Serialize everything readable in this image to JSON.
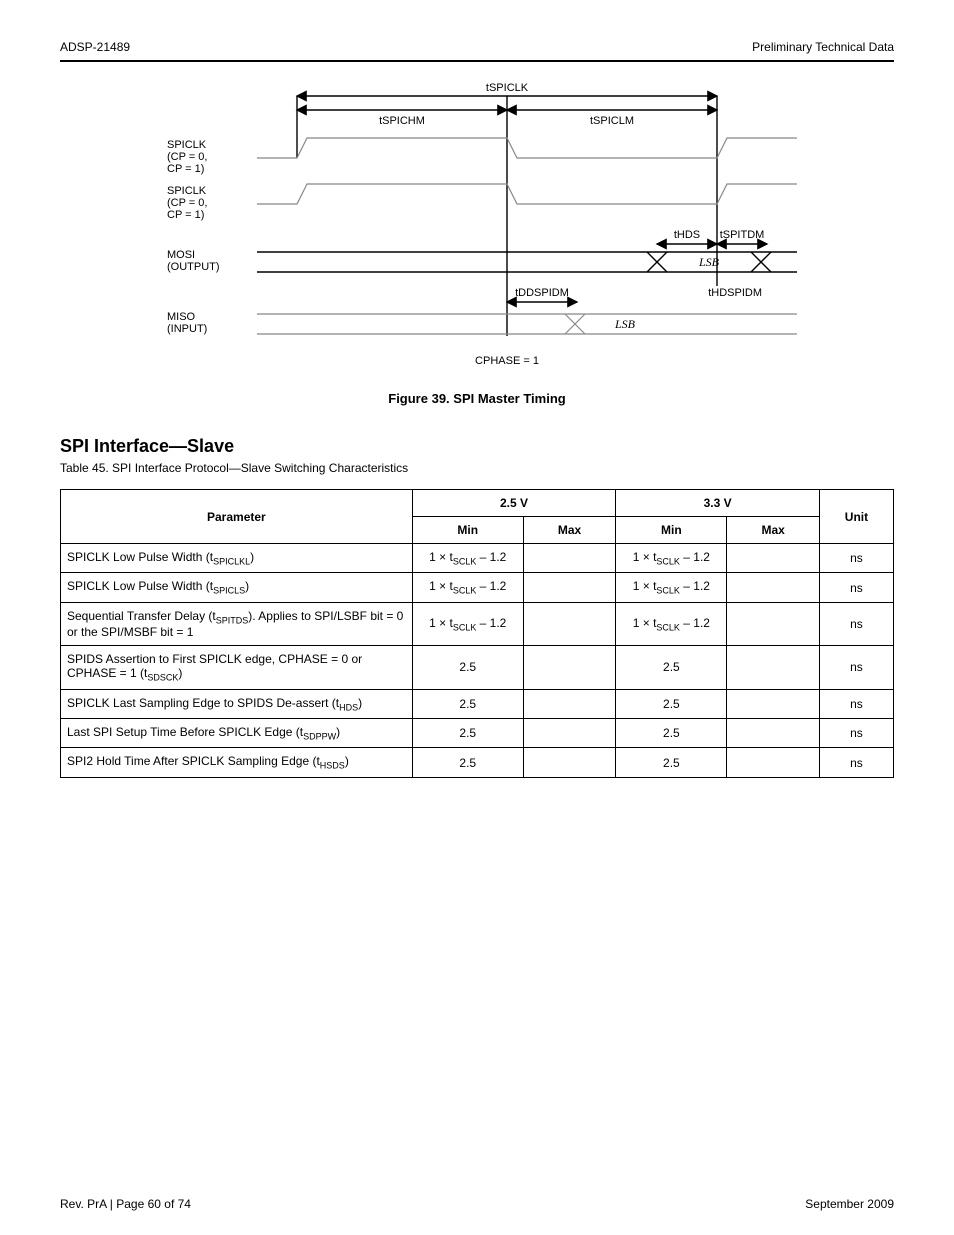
{
  "header": {
    "left": "ADSP-21489",
    "right": "Preliminary Technical Data"
  },
  "diagram": {
    "tSPICLK": "tSPICLK",
    "tHDS": "tHDS",
    "tSPITDM": "tSPITDM",
    "tSPICHM": "tSPICHM",
    "tSPICLM": "tSPICLM",
    "tDDSPIDM": "tDDSPIDM",
    "tHDSPIDM": "tHDSPIDM",
    "spiclk_cpol0": "SPICLK\n(CP = 0,\nCP = 1)",
    "spiclk_cpol1": "SPICLK\n(CP = 0,\nCP = 1)",
    "mosi_out": "MOSI\n(OUTPUT)",
    "miso_in": "MISO\n(INPUT)",
    "lsb_in": "LSB",
    "lsb_out": "LSB",
    "cphase1": "CPHASE = 1"
  },
  "figureCaption": "Figure 39. SPI Master Timing",
  "tableTitle": "SPI Interface—Slave",
  "tableSub": {
    "pre": "Table 45. SPI Interface Protocol—Slave Switching Characteristics",
    "post": ""
  },
  "cols": {
    "parameter": "Parameter",
    "min25": "Min",
    "max25": "Max",
    "min33": "Min",
    "max33": "Max",
    "unit": "Unit"
  },
  "voltHeaders": {
    "v25": "2.5 V",
    "v33": "3.3 V"
  },
  "rows": [
    {
      "desc": "SPICLK Low Pulse Width (tSPICLKL)",
      "descHtml": "SPICLK Low Pulse Width (t<sub>SPICLKL</sub>)",
      "min25": "1 × tSCLK – 1.2",
      "min25Html": "1 × t<sub>SCLK</sub> – 1.2",
      "max25": "",
      "min33": "1 × tSCLK – 1.2",
      "min33Html": "1 × t<sub>SCLK</sub> – 1.2",
      "max33": "",
      "unit": "ns"
    },
    {
      "desc": "SPICLK Low Pulse Width (tSPICLS)",
      "descHtml": "SPICLK Low Pulse Width (t<sub>SPICLS</sub>)",
      "min25": "1 × tSCLK – 1.2",
      "min25Html": "1 × t<sub>SCLK</sub> – 1.2",
      "max25": "",
      "min33": "1 × tSCLK – 1.2",
      "min33Html": "1 × t<sub>SCLK</sub> – 1.2",
      "max33": "",
      "unit": "ns"
    },
    {
      "desc": "Sequential Transfer Delay (tSPITDS). Applies to SPI/LSBF bit = 0 or the SPI/MSBF bit = 1",
      "descHtml": "Sequential Transfer Delay (t<sub>SPITDS</sub>). Applies to SPI/LSBF bit = 0 or the SPI/MSBF bit = 1",
      "min25": "1 × tSCLK – 1.2",
      "min25Html": "1 × t<sub>SCLK</sub> – 1.2",
      "max25": "",
      "min33": "1 × tSCLK – 1.2",
      "min33Html": "1 × t<sub>SCLK</sub> – 1.2",
      "max33": "",
      "unit": "ns"
    },
    {
      "desc": "SPIDS Assertion to First SPICLK edge, CPHASE = 0 or CPHASE = 1 (tSDSCK)",
      "descHtml": "SPIDS Assertion to First SPICLK edge, CPHASE = 0 or CPHASE = 1 (t<sub>SDSCK</sub>)",
      "min25": "2.5",
      "max25": "",
      "min33": "2.5",
      "max33": "",
      "unit": "ns"
    },
    {
      "desc": "SPICLK Last Sampling Edge to SPIDS De-assert (tHDS)",
      "descHtml": "SPICLK Last Sampling Edge to SPIDS De-assert (t<sub>HDS</sub>)",
      "min25": "2.5",
      "max25": "",
      "min33": "2.5",
      "max33": "",
      "unit": "ns"
    },
    {
      "desc": "Last SPI Setup Time Before SPICLK Edge (tSDPPW)",
      "descHtml": "Last SPI Setup Time Before SPICLK Edge (t<sub>SDPPW</sub>)",
      "min25": "2.5",
      "max25": "",
      "min33": "2.5",
      "max33": "",
      "unit": "ns"
    },
    {
      "desc": "SPI2 Hold Time After SPICLK Sampling Edge (tHSDS)",
      "descHtml": "SPI2 Hold Time After SPICLK Sampling Edge (t<sub>HSDS</sub>)",
      "min25": "2.5",
      "max25": "",
      "min33": "2.5",
      "max33": "",
      "unit": "ns"
    }
  ],
  "footer": {
    "revision": "Rev. PrA | Page 60 of 74",
    "date": "September 2009"
  }
}
